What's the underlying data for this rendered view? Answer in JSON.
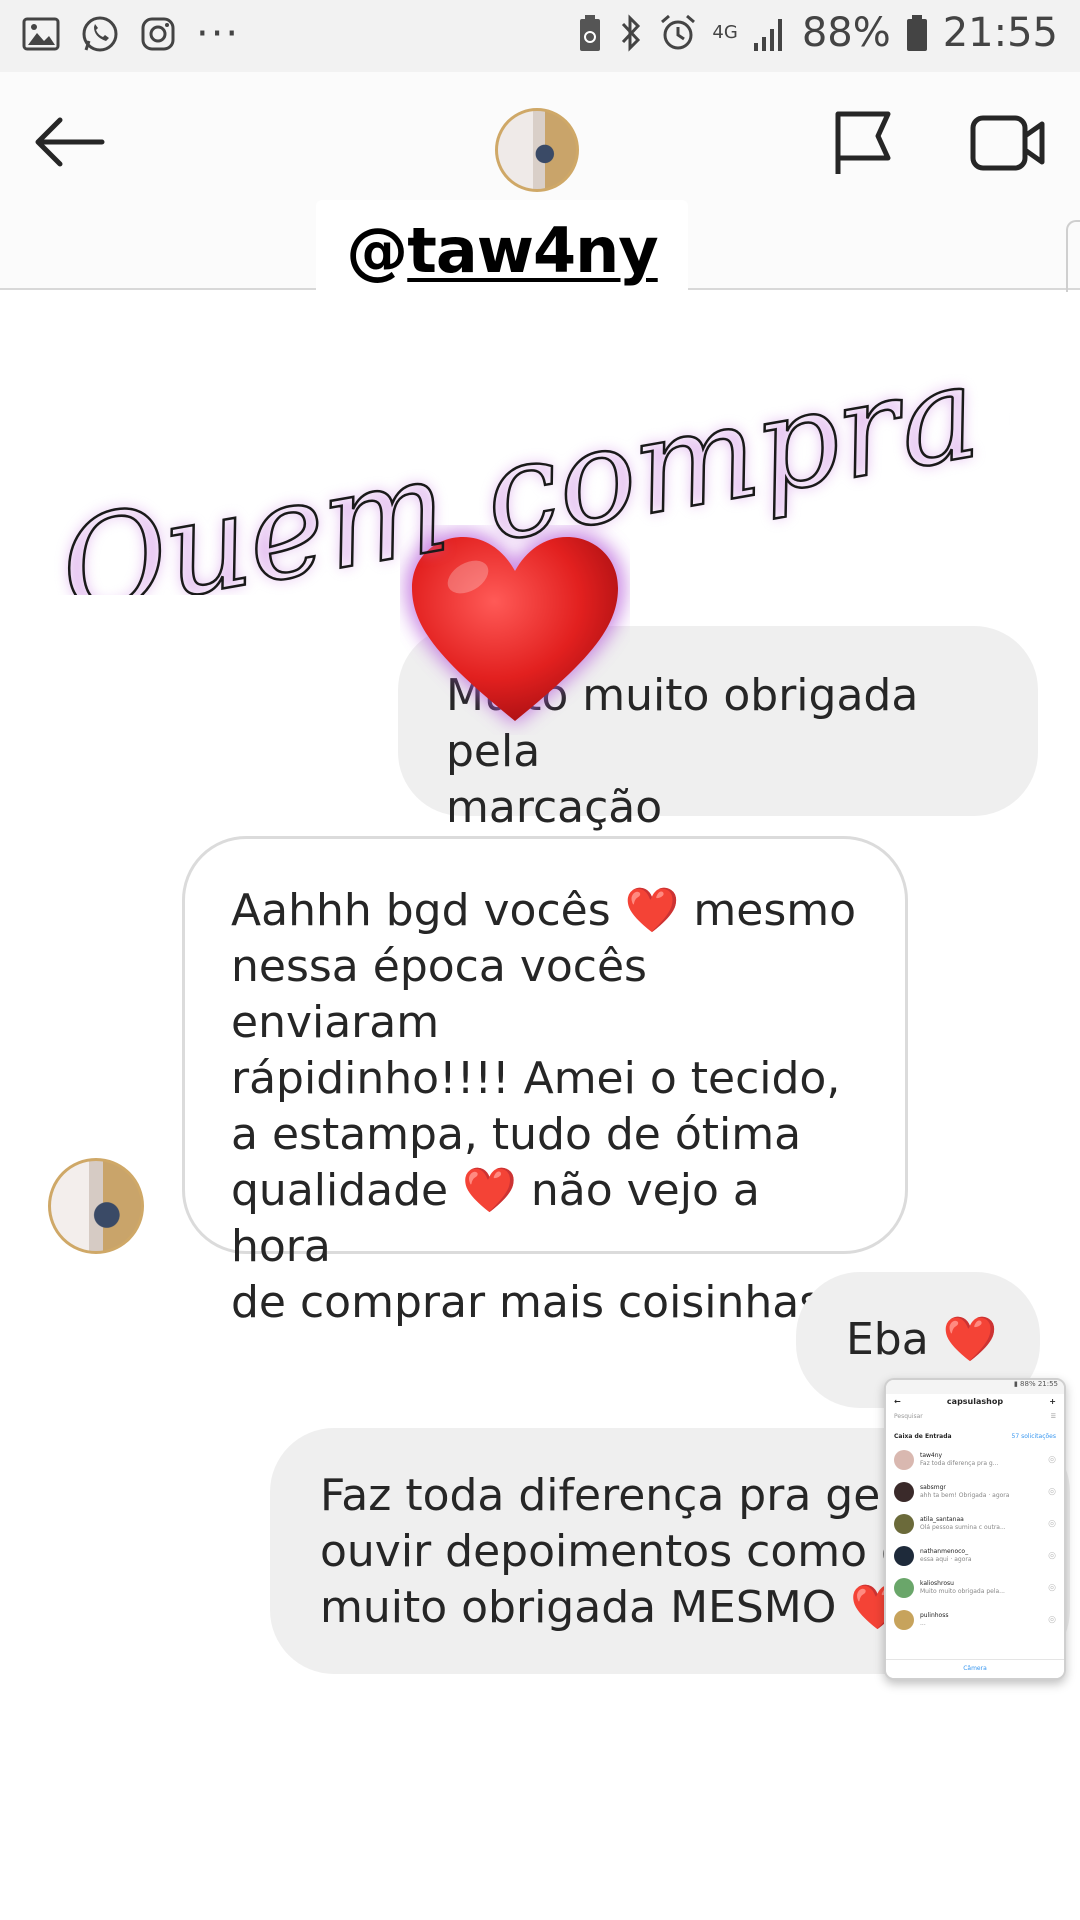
{
  "status_bar": {
    "battery": "88%",
    "time": "21:55",
    "network": "4G",
    "left_icons": [
      "gallery-icon",
      "whatsapp-icon",
      "instagram-icon"
    ],
    "more": "···"
  },
  "header": {
    "username": "taw4ny",
    "username_prefix": "@"
  },
  "sticker": {
    "text": "Quem compra ama"
  },
  "messages": [
    {
      "direction": "outgoing",
      "text": "Muito muito obrigada pela marcação",
      "line1": "Muito muito obrigada pela",
      "line2": "marcação"
    },
    {
      "direction": "incoming",
      "lines": [
        "Aahhh bgd vocês ❤️ mesmo",
        "nessa época vocês enviaram",
        "rápidinho!!!! Amei o tecido,",
        "a estampa, tudo de ótima",
        "qualidade ❤️ não vejo a hora",
        "de comprar mais coisinhas"
      ]
    },
    {
      "direction": "outgoing",
      "text": "Eba ❤️"
    },
    {
      "direction": "outgoing",
      "lines": [
        "Faz toda diferença pra gente",
        "ouvir depoimentos como o seu",
        "muito obrigada MESMO ❤️"
      ]
    }
  ],
  "mini_screenshot": {
    "title": "capsulashop",
    "search": "Pesquisar",
    "inbox_label": "Caixa de Entrada",
    "requests": "57 solicitações",
    "rows": [
      {
        "name": "taw4ny",
        "preview": "Faz toda diferença pra g...",
        "color": "#d9b8b0"
      },
      {
        "name": "sabsmgr",
        "preview": "ahh ta bem! Obrigada · agora",
        "color": "#3a2a2a"
      },
      {
        "name": "atila_santanaa",
        "preview": "Olá pessoa sumina c outra...",
        "color": "#6b6a3a"
      },
      {
        "name": "nathanmenoco_",
        "preview": "essa aqui · agora",
        "color": "#1e2a3a"
      },
      {
        "name": "kalioshrosu",
        "preview": "Muito muito obrigada pela...",
        "color": "#6aa66a"
      },
      {
        "name": "pulinhoss",
        "preview": "...",
        "color": "#c7a35c"
      }
    ],
    "camera_label": "Câmera"
  }
}
